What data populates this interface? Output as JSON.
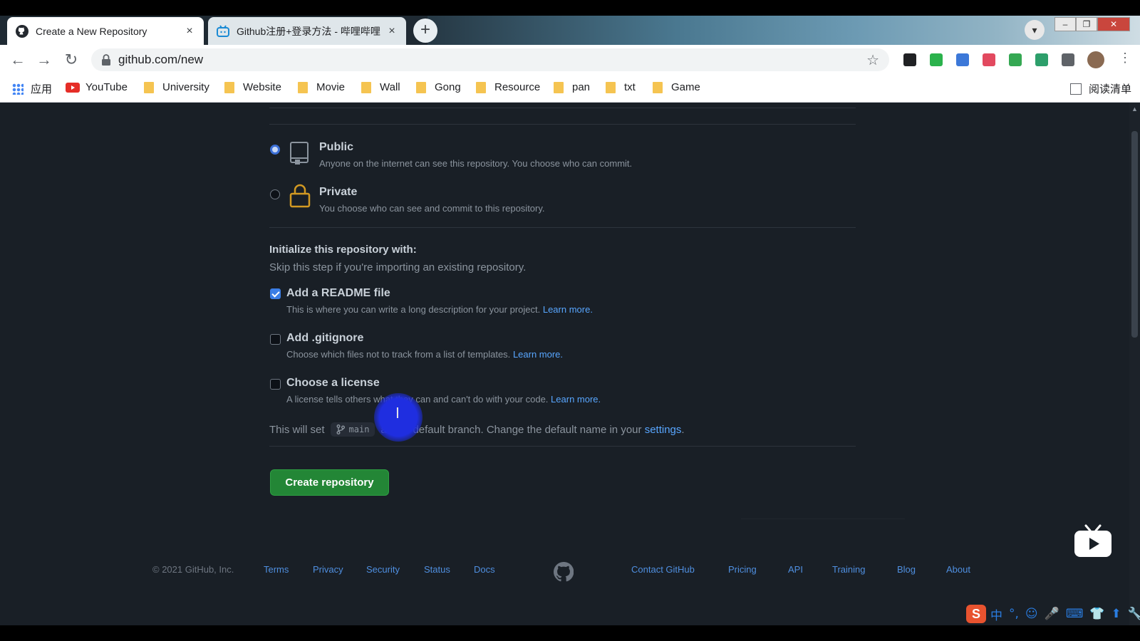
{
  "browser": {
    "tabs": [
      {
        "title": "Create a New Repository",
        "close": "×",
        "active": true
      },
      {
        "title": "Github注册+登录方法 - 哔哩哔哩",
        "close": "×",
        "active": false
      }
    ],
    "new_tab": "+",
    "window_controls": {
      "minimize": "–",
      "maximize": "❐",
      "close": "✕"
    },
    "url": "github.com/new",
    "nav": {
      "back": "←",
      "forward": "→",
      "reload": "↻",
      "star": "☆",
      "menu": "⋮"
    },
    "bookmarks": [
      {
        "label": "应用",
        "icon": "apps-grid-icon"
      },
      {
        "label": "YouTube",
        "icon": "youtube-icon"
      },
      {
        "label": "University",
        "icon": "folder-icon"
      },
      {
        "label": "Website",
        "icon": "folder-icon"
      },
      {
        "label": "Movie",
        "icon": "folder-icon"
      },
      {
        "label": "Wall",
        "icon": "folder-icon"
      },
      {
        "label": "Gong",
        "icon": "folder-icon"
      },
      {
        "label": "Resource",
        "icon": "folder-icon"
      },
      {
        "label": "pan",
        "icon": "folder-icon"
      },
      {
        "label": "txt",
        "icon": "folder-icon"
      },
      {
        "label": "Game",
        "icon": "folder-icon"
      }
    ],
    "reading_list": "阅读清单"
  },
  "visibility": {
    "public": {
      "title": "Public",
      "desc": "Anyone on the internet can see this repository. You choose who can commit.",
      "selected": true
    },
    "private": {
      "title": "Private",
      "desc": "You choose who can see and commit to this repository.",
      "selected": false
    }
  },
  "init": {
    "heading": "Initialize this repository with:",
    "sub": "Skip this step if you're importing an existing repository.",
    "options": [
      {
        "title": "Add a README file",
        "desc": "This is where you can write a long description for your project.",
        "link": "Learn more.",
        "checked": true
      },
      {
        "title": "Add .gitignore",
        "desc": "Choose which files not to track from a list of templates.",
        "link": "Learn more.",
        "checked": false
      },
      {
        "title": "Choose a license",
        "desc": "A license tells others what they can and can't do with your code.",
        "link": "Learn more.",
        "checked": false
      }
    ],
    "branch_prefix": "This will set",
    "branch_name": "main",
    "branch_suffix": "as the default branch. Change the default name in your",
    "branch_link": "settings",
    "branch_end": "."
  },
  "create_button": "Create repository",
  "footer": {
    "copyright": "© 2021 GitHub, Inc.",
    "left_links": [
      "Terms",
      "Privacy",
      "Security",
      "Status",
      "Docs"
    ],
    "right_links": [
      "Contact GitHub",
      "Pricing",
      "API",
      "Training",
      "Blog",
      "About"
    ]
  },
  "ime": {
    "logo": "S",
    "items": [
      "中",
      "°,",
      "☺",
      "🎤",
      "⌨",
      "👕",
      "⬆",
      "🔧"
    ]
  },
  "colors": {
    "accent_link": "#58a6ff",
    "create_green": "#238636",
    "page_bg": "#191f26"
  }
}
